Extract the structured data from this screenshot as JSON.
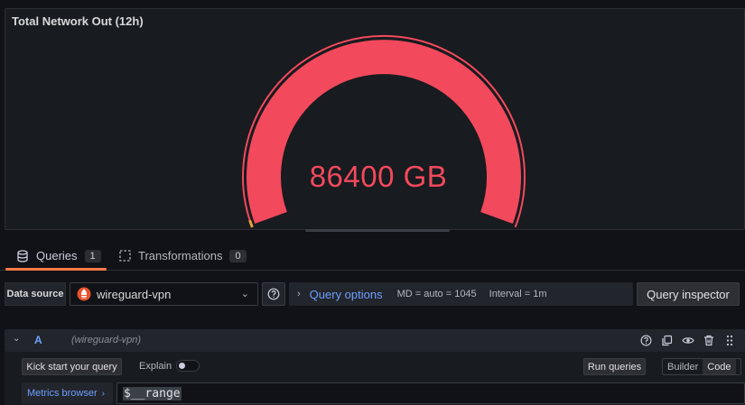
{
  "panel": {
    "title": "Total Network Out (12h)",
    "value": "86400 GB",
    "gauge_fraction": 1.0,
    "colors": {
      "arc": "#f2495c",
      "threshold_start": "#e6a23c",
      "background": "#181b1f"
    }
  },
  "tabs": [
    {
      "label": "Queries",
      "count": "1",
      "icon": "database-icon",
      "active": true
    },
    {
      "label": "Transformations",
      "count": "0",
      "icon": "transform-icon",
      "active": false
    }
  ],
  "datasource": {
    "label": "Data source",
    "selected": "wireguard-vpn",
    "query_options_label": "Query options",
    "md": "MD = auto = 1045",
    "interval": "Interval = 1m",
    "inspector_label": "Query inspector"
  },
  "query": {
    "ref_id": "A",
    "datasource_name": "(wireguard-vpn)",
    "kick_start_label": "Kick start your query",
    "explain_label": "Explain",
    "explain_enabled": false,
    "run_label": "Run queries",
    "modes": [
      "Builder",
      "Code"
    ],
    "active_mode": "Code",
    "metrics_browser_label": "Metrics browser",
    "expression": "$__range"
  }
}
